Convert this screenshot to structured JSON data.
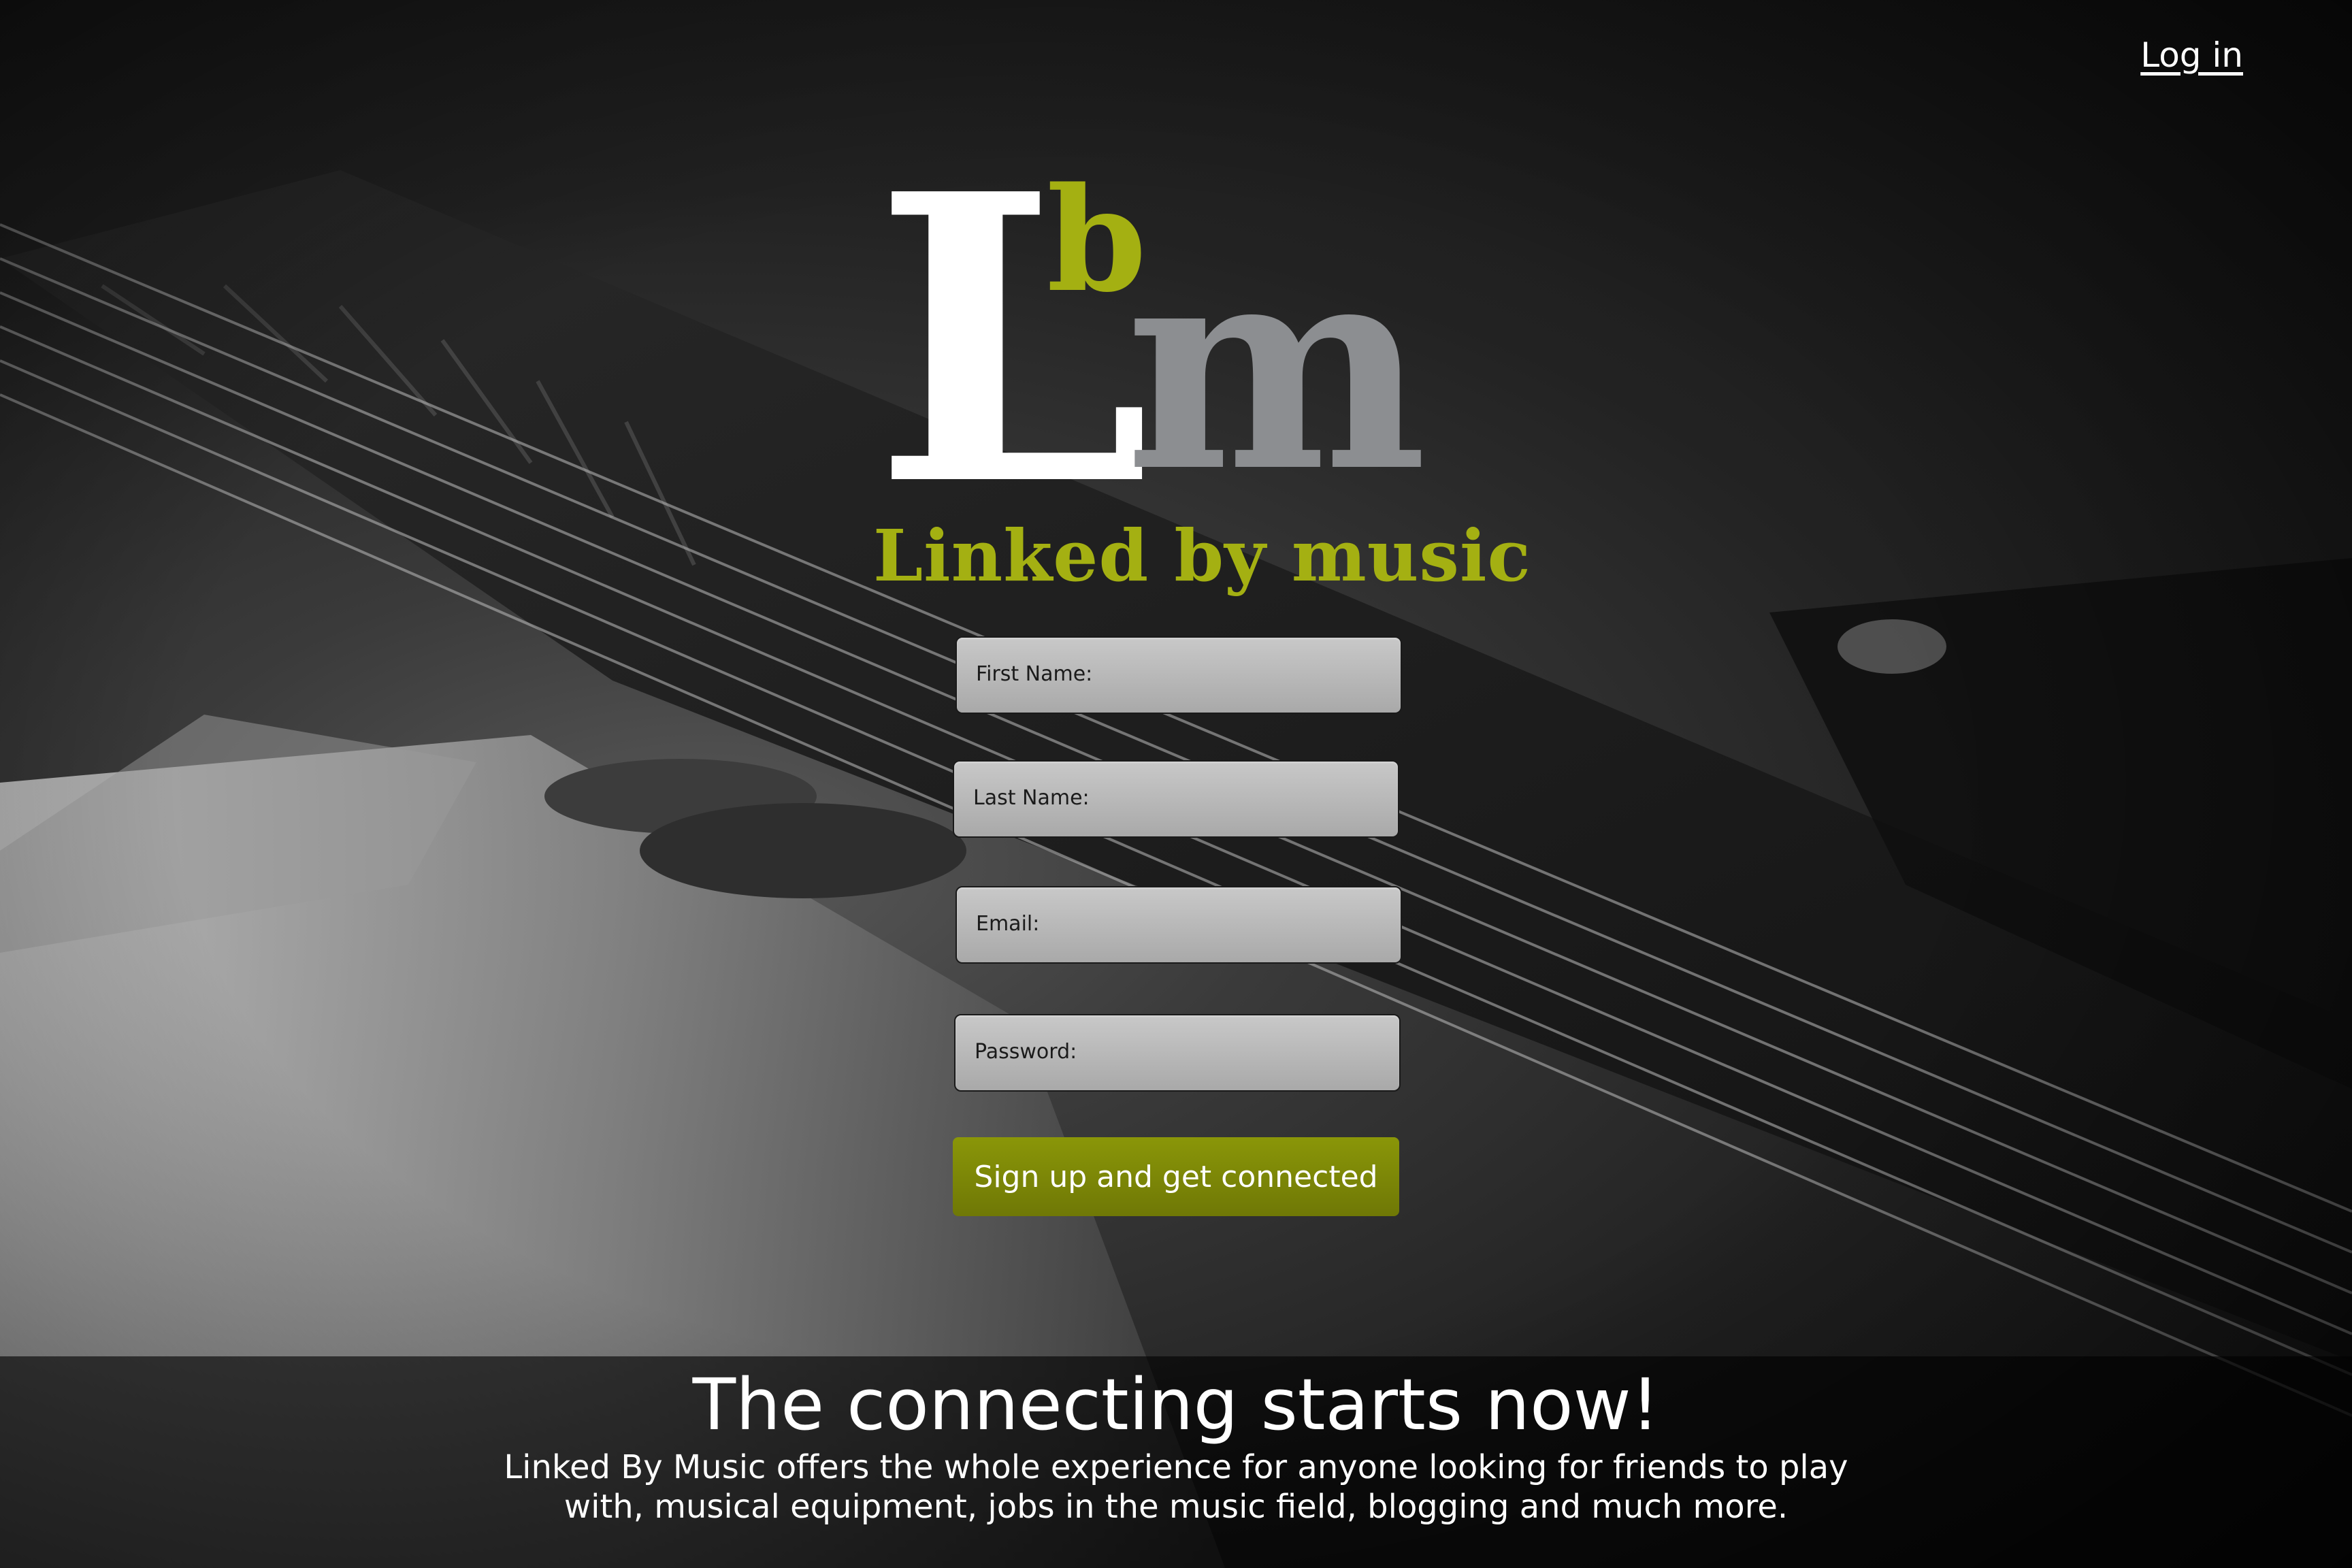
{
  "header": {
    "login_label": "Log in"
  },
  "logo": {
    "letter_L": "L",
    "letter_b": "b",
    "letter_m": "m",
    "wordmark": "Linked by music",
    "colors": {
      "L": "#ffffff",
      "b": "#a4b012",
      "m": "#8c8e91",
      "wordmark": "#a4b012"
    }
  },
  "form": {
    "fields": [
      {
        "label": "First Name:",
        "value": ""
      },
      {
        "label": "Last Name:",
        "value": ""
      },
      {
        "label": "Email:",
        "value": ""
      },
      {
        "label": "Password:",
        "value": ""
      }
    ],
    "submit_label": "Sign up and get connected"
  },
  "banner": {
    "title": "The connecting starts now!",
    "description": "Linked By Music offers the whole experience for anyone looking for friends to play with, musical equipment, jobs in the music field, blogging and much more."
  },
  "colors": {
    "accent": "#a4b012",
    "button": "#7d8807",
    "field_bg": "#b8b8b8"
  }
}
